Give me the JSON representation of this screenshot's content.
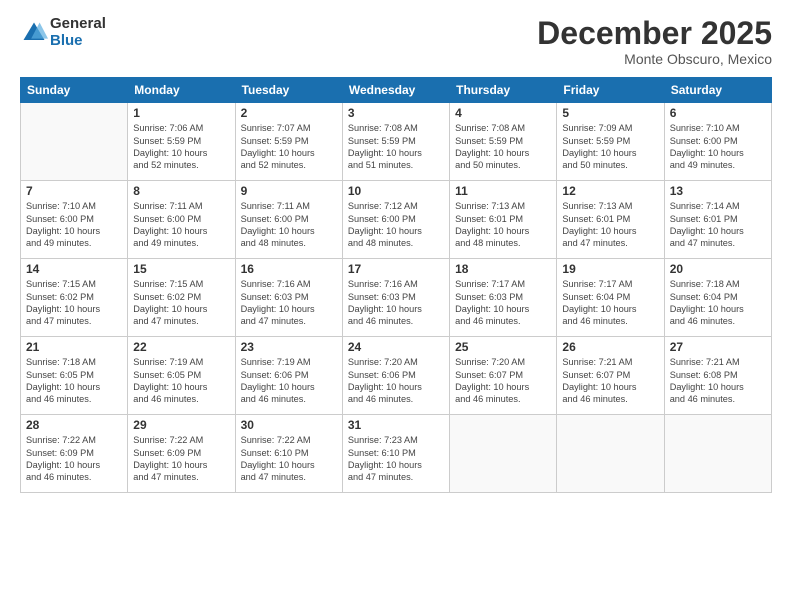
{
  "logo": {
    "general": "General",
    "blue": "Blue"
  },
  "header": {
    "month": "December 2025",
    "location": "Monte Obscuro, Mexico"
  },
  "weekdays": [
    "Sunday",
    "Monday",
    "Tuesday",
    "Wednesday",
    "Thursday",
    "Friday",
    "Saturday"
  ],
  "weeks": [
    [
      {
        "day": "",
        "info": ""
      },
      {
        "day": "1",
        "info": "Sunrise: 7:06 AM\nSunset: 5:59 PM\nDaylight: 10 hours\nand 52 minutes."
      },
      {
        "day": "2",
        "info": "Sunrise: 7:07 AM\nSunset: 5:59 PM\nDaylight: 10 hours\nand 52 minutes."
      },
      {
        "day": "3",
        "info": "Sunrise: 7:08 AM\nSunset: 5:59 PM\nDaylight: 10 hours\nand 51 minutes."
      },
      {
        "day": "4",
        "info": "Sunrise: 7:08 AM\nSunset: 5:59 PM\nDaylight: 10 hours\nand 50 minutes."
      },
      {
        "day": "5",
        "info": "Sunrise: 7:09 AM\nSunset: 5:59 PM\nDaylight: 10 hours\nand 50 minutes."
      },
      {
        "day": "6",
        "info": "Sunrise: 7:10 AM\nSunset: 6:00 PM\nDaylight: 10 hours\nand 49 minutes."
      }
    ],
    [
      {
        "day": "7",
        "info": "Sunrise: 7:10 AM\nSunset: 6:00 PM\nDaylight: 10 hours\nand 49 minutes."
      },
      {
        "day": "8",
        "info": "Sunrise: 7:11 AM\nSunset: 6:00 PM\nDaylight: 10 hours\nand 49 minutes."
      },
      {
        "day": "9",
        "info": "Sunrise: 7:11 AM\nSunset: 6:00 PM\nDaylight: 10 hours\nand 48 minutes."
      },
      {
        "day": "10",
        "info": "Sunrise: 7:12 AM\nSunset: 6:00 PM\nDaylight: 10 hours\nand 48 minutes."
      },
      {
        "day": "11",
        "info": "Sunrise: 7:13 AM\nSunset: 6:01 PM\nDaylight: 10 hours\nand 48 minutes."
      },
      {
        "day": "12",
        "info": "Sunrise: 7:13 AM\nSunset: 6:01 PM\nDaylight: 10 hours\nand 47 minutes."
      },
      {
        "day": "13",
        "info": "Sunrise: 7:14 AM\nSunset: 6:01 PM\nDaylight: 10 hours\nand 47 minutes."
      }
    ],
    [
      {
        "day": "14",
        "info": "Sunrise: 7:15 AM\nSunset: 6:02 PM\nDaylight: 10 hours\nand 47 minutes."
      },
      {
        "day": "15",
        "info": "Sunrise: 7:15 AM\nSunset: 6:02 PM\nDaylight: 10 hours\nand 47 minutes."
      },
      {
        "day": "16",
        "info": "Sunrise: 7:16 AM\nSunset: 6:03 PM\nDaylight: 10 hours\nand 47 minutes."
      },
      {
        "day": "17",
        "info": "Sunrise: 7:16 AM\nSunset: 6:03 PM\nDaylight: 10 hours\nand 46 minutes."
      },
      {
        "day": "18",
        "info": "Sunrise: 7:17 AM\nSunset: 6:03 PM\nDaylight: 10 hours\nand 46 minutes."
      },
      {
        "day": "19",
        "info": "Sunrise: 7:17 AM\nSunset: 6:04 PM\nDaylight: 10 hours\nand 46 minutes."
      },
      {
        "day": "20",
        "info": "Sunrise: 7:18 AM\nSunset: 6:04 PM\nDaylight: 10 hours\nand 46 minutes."
      }
    ],
    [
      {
        "day": "21",
        "info": "Sunrise: 7:18 AM\nSunset: 6:05 PM\nDaylight: 10 hours\nand 46 minutes."
      },
      {
        "day": "22",
        "info": "Sunrise: 7:19 AM\nSunset: 6:05 PM\nDaylight: 10 hours\nand 46 minutes."
      },
      {
        "day": "23",
        "info": "Sunrise: 7:19 AM\nSunset: 6:06 PM\nDaylight: 10 hours\nand 46 minutes."
      },
      {
        "day": "24",
        "info": "Sunrise: 7:20 AM\nSunset: 6:06 PM\nDaylight: 10 hours\nand 46 minutes."
      },
      {
        "day": "25",
        "info": "Sunrise: 7:20 AM\nSunset: 6:07 PM\nDaylight: 10 hours\nand 46 minutes."
      },
      {
        "day": "26",
        "info": "Sunrise: 7:21 AM\nSunset: 6:07 PM\nDaylight: 10 hours\nand 46 minutes."
      },
      {
        "day": "27",
        "info": "Sunrise: 7:21 AM\nSunset: 6:08 PM\nDaylight: 10 hours\nand 46 minutes."
      }
    ],
    [
      {
        "day": "28",
        "info": "Sunrise: 7:22 AM\nSunset: 6:09 PM\nDaylight: 10 hours\nand 46 minutes."
      },
      {
        "day": "29",
        "info": "Sunrise: 7:22 AM\nSunset: 6:09 PM\nDaylight: 10 hours\nand 47 minutes."
      },
      {
        "day": "30",
        "info": "Sunrise: 7:22 AM\nSunset: 6:10 PM\nDaylight: 10 hours\nand 47 minutes."
      },
      {
        "day": "31",
        "info": "Sunrise: 7:23 AM\nSunset: 6:10 PM\nDaylight: 10 hours\nand 47 minutes."
      },
      {
        "day": "",
        "info": ""
      },
      {
        "day": "",
        "info": ""
      },
      {
        "day": "",
        "info": ""
      }
    ]
  ]
}
